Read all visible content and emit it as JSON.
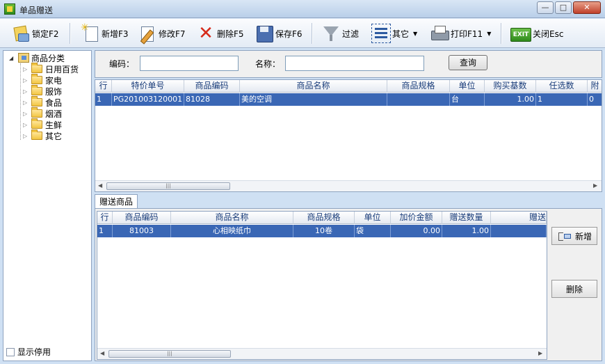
{
  "window": {
    "title": "单品赠送",
    "minimize_glyph": "—",
    "maximize_glyph": "□",
    "close_glyph": "✕"
  },
  "toolbar": {
    "lock_label": "锁定F2",
    "new_label": "新增F3",
    "edit_label": "修改F7",
    "delete_label": "删除F5",
    "save_label": "保存F6",
    "filter_label": "过滤",
    "other_label": "其它",
    "print_label": "打印F11",
    "exit_icon_text": "EXIT",
    "close_label": "关闭Esc"
  },
  "tree": {
    "root_label": "商品分类",
    "items": [
      "日用百货",
      "家电",
      "服饰",
      "食品",
      "烟酒",
      "生鲜",
      "其它"
    ]
  },
  "show_disabled_label": "显示停用",
  "search": {
    "code_label": "编码：",
    "name_label": "名称：",
    "code_value": "",
    "name_value": "",
    "query_label": "查询"
  },
  "main_grid": {
    "headers": [
      "行",
      "特价单号",
      "商品编码",
      "商品名称",
      "商品规格",
      "单位",
      "购买基数",
      "任选数",
      "附"
    ],
    "rows": [
      [
        "1",
        "PG201003120001",
        "81028",
        "美的空调",
        "",
        "台",
        "1.00",
        "1",
        "0"
      ]
    ]
  },
  "gift_tab_label": "赠送商品",
  "gift_grid": {
    "headers": [
      "行",
      "商品编码",
      "商品名称",
      "商品规格",
      "单位",
      "加价金额",
      "赠送数量",
      "赠送"
    ],
    "rows": [
      [
        "1",
        "81003",
        "心相映纸巾",
        "10卷",
        "袋",
        "0.00",
        "1.00",
        ""
      ]
    ]
  },
  "gift_actions": {
    "add_label": "新增",
    "remove_label": "删除"
  },
  "scrollbar_grip": "|||"
}
